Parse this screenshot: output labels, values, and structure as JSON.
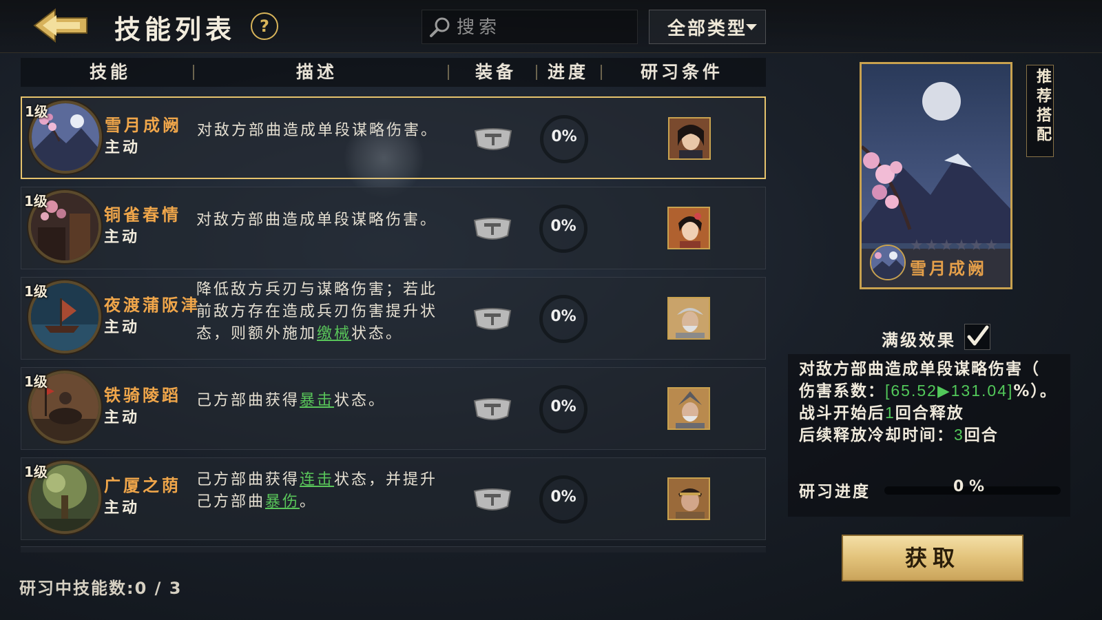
{
  "header": {
    "title": "技能列表",
    "help_label": "?",
    "search_placeholder": "搜索",
    "type_filter": "全部类型"
  },
  "table": {
    "columns": [
      "技能",
      "描述",
      "装备",
      "进度",
      "研习条件"
    ],
    "rows": [
      {
        "level": "1级",
        "name": "雪月成阙",
        "type": "主动",
        "desc_parts": [
          "对敌方部曲造成单段谋略伤害。"
        ],
        "progress": "0%",
        "selected": true
      },
      {
        "level": "1级",
        "name": "铜雀春情",
        "type": "主动",
        "desc_parts": [
          "对敌方部曲造成单段谋略伤害。"
        ],
        "progress": "0%",
        "selected": false
      },
      {
        "level": "1级",
        "name": "夜渡蒲阪津",
        "type": "主动",
        "desc_line1": "降低敌方兵刃与谋略伤害；若此",
        "desc_line2": "前敌方存在造成兵刃伤害提升状",
        "desc_line3_pre": "态，则额外施加",
        "desc_line3_link": "缴械",
        "desc_line3_post": "状态。",
        "progress": "0%",
        "selected": false
      },
      {
        "level": "1级",
        "name": "铁骑陵蹈",
        "type": "主动",
        "desc_pre": "己方部曲获得",
        "desc_link": "暴击",
        "desc_post": "状态。",
        "progress": "0%",
        "selected": false
      },
      {
        "level": "1级",
        "name": "广厦之荫",
        "type": "主动",
        "desc_line1_pre": "己方部曲获得",
        "desc_line1_link": "连击",
        "desc_line1_post": "状态，并提升",
        "desc_line2_pre": "己方部曲",
        "desc_line2_link": "暴伤",
        "desc_line2_post": "。",
        "progress": "0%",
        "selected": false
      }
    ]
  },
  "footer": {
    "research_count_label": "研习中技能数:",
    "research_count_value": "0 / 3"
  },
  "detail": {
    "card_name": "雪月成阙",
    "card_stars": "★★★★★★",
    "recommend_label": "推荐搭配",
    "max_effect_label": "满级效果",
    "effect_line1": "对敌方部曲造成单段谋略伤害（",
    "effect_line2_pre": "伤害系数：",
    "effect_line2_values": "[65.52▶131.04]",
    "effect_line2_post": "%）。",
    "effect_line3_pre": "战斗开始后",
    "effect_line3_value": "1",
    "effect_line3_post": "回合释放",
    "effect_line4_pre": "后续释放冷却时间：",
    "effect_line4_value": "3",
    "effect_line4_post": "回合",
    "research_label": "研习进度",
    "research_value": "0 %",
    "acquire_label": "获取"
  },
  "colors": {
    "accent_gold": "#c9a24f",
    "skill_name": "#f0a64a",
    "keyword_green": "#52c85a"
  }
}
